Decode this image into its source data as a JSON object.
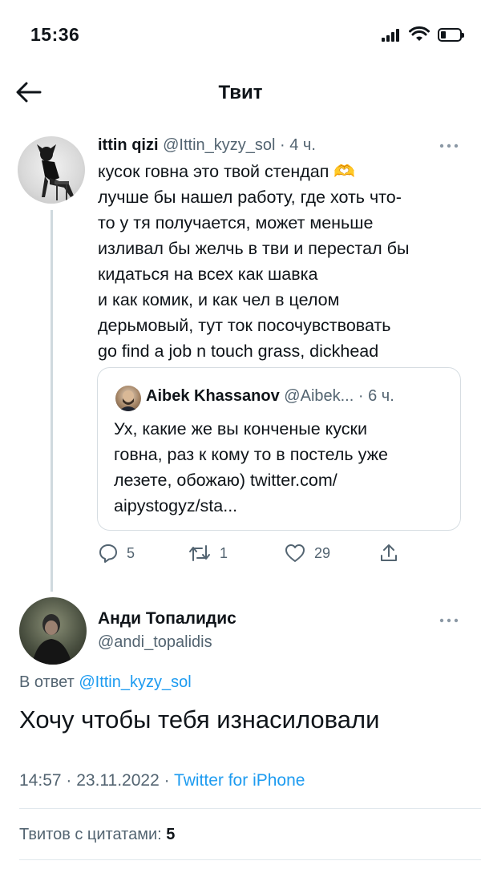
{
  "status_bar": {
    "time": "15:36"
  },
  "header": {
    "title": "Твит"
  },
  "tweet1": {
    "name": "ittin qizi",
    "handle": "@Ittin_kyzy_sol",
    "sep": " · ",
    "time": "4 ч.",
    "body_lines": [
      "кусок говна это твой стендап 🫶",
      "лучше бы нашел работу, где хоть что-",
      "то у тя получается, может меньше",
      "изливал бы желчь в тви и перестал бы",
      "кидаться на всех как шавка",
      "и как комик, и как чел в целом",
      "дерьмовый, тут ток посочувствовать",
      "go find a job n touch grass, dickhead"
    ],
    "quote": {
      "name": "Aibek Khassanov",
      "handle": "@Aibek...",
      "sep": " · ",
      "time": "6 ч.",
      "body_lines": [
        "Ух, какие же вы конченые куски",
        "говна, раз к кому то в постель уже",
        "лезете, обожаю) twitter.com/",
        "aipystogyz/sta..."
      ]
    },
    "actions": {
      "replies": "5",
      "retweets": "1",
      "likes": "29"
    }
  },
  "tweet2": {
    "name": "Анди Топалидис",
    "handle": "@andi_topalidis",
    "reply_prefix": "В ответ ",
    "reply_mention": "@Ittin_kyzy_sol",
    "text": "Хочу чтобы тебя изнасиловали",
    "timestamp": "14:57 · 23.11.2022 · ",
    "source": "Twitter for iPhone",
    "quotes_label": "Твитов с цитатами: ",
    "quotes_count": "5"
  },
  "icons": {
    "back": "arrow-left-icon",
    "more": "more-dots-icon",
    "reply": "comment-icon",
    "retweet": "retweet-icon",
    "like": "heart-icon",
    "share": "share-icon"
  },
  "colors": {
    "link": "#1d9bf0",
    "secondary_text": "#536471",
    "text": "#0f1419",
    "border": "#cfd9de"
  }
}
